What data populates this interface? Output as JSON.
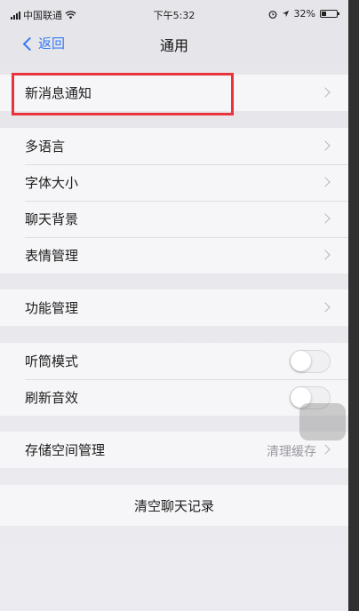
{
  "status_bar": {
    "carrier": "中国联通",
    "time": "下午5:32",
    "battery": "32%",
    "battery_level": 0.32
  },
  "nav": {
    "back_label": "返回",
    "title": "通用"
  },
  "groups": [
    {
      "rows": [
        {
          "label": "新消息通知",
          "control": "chevron"
        }
      ]
    },
    {
      "rows": [
        {
          "label": "多语言",
          "control": "chevron"
        },
        {
          "label": "字体大小",
          "control": "chevron"
        },
        {
          "label": "聊天背景",
          "control": "chevron"
        },
        {
          "label": "表情管理",
          "control": "chevron"
        }
      ]
    },
    {
      "rows": [
        {
          "label": "功能管理",
          "control": "chevron"
        }
      ]
    },
    {
      "rows": [
        {
          "label": "听筒模式",
          "control": "toggle",
          "on": false
        },
        {
          "label": "刷新音效",
          "control": "toggle",
          "on": false
        }
      ]
    },
    {
      "rows": [
        {
          "label": "存储空间管理",
          "control": "chevron",
          "detail": "清理缓存"
        }
      ]
    }
  ],
  "clear_button": "清空聊天记录",
  "colors": {
    "accent": "#3478f6",
    "highlight": "#e8343a"
  }
}
